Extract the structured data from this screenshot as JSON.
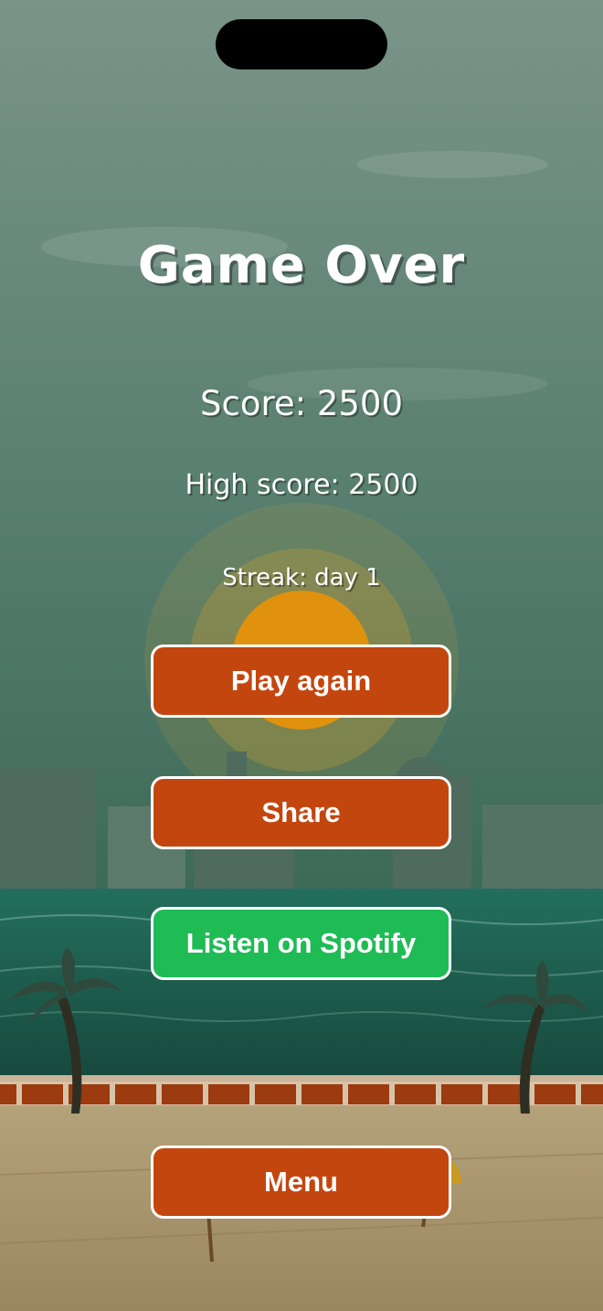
{
  "game": {
    "title": "Game Over",
    "score_text": "Score: 2500",
    "high_score_text": "High score: 2500",
    "streak_text": "Streak: day 1"
  },
  "buttons": {
    "play_again": "Play again",
    "share": "Share",
    "spotify": "Listen on Spotify",
    "menu": "Menu"
  },
  "colors": {
    "sky_top": "#7a9488",
    "sky_bottom": "#3d6a58",
    "sea": "#1f6a5a",
    "sand": "#b29f78",
    "button_orange": "#c4460f",
    "button_green": "#1fbb55",
    "sun": "#e0920f",
    "wall_brick": "#9c3a10"
  }
}
